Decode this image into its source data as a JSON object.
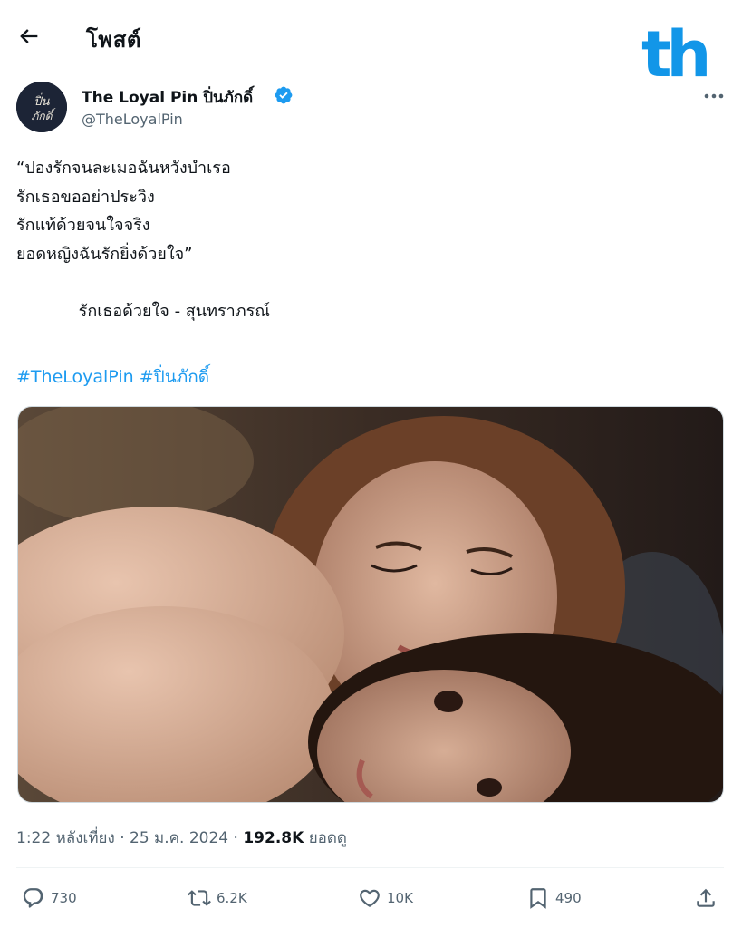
{
  "header": {
    "title": "โพสต์"
  },
  "author": {
    "name": "The Loyal Pin ปิ่นภักดิ์",
    "handle": "@TheLoyalPin",
    "avatar_text": "ปิ่น ภักดิ์"
  },
  "tweet": {
    "text": "“ปองรักจนละเมอฉันหวังบำเรอ\nรักเธอขออย่าประวิง\nรักแท้ด้วยจนใจจริง\nยอดหญิงฉันรักยิ่งด้วยใจ”\n\n            รักเธอด้วยใจ - สุนทราภรณ์",
    "hashtags": [
      "#TheLoyalPin",
      "#ปิ่นภักดิ์"
    ]
  },
  "meta": {
    "time": "1:22 หลังเที่ยง",
    "date": "25 ม.ค. 2024",
    "views": "192.8K",
    "views_label": "ยอดดู",
    "separator": "·"
  },
  "actions": {
    "replies": "730",
    "reposts": "6.2K",
    "likes": "10K",
    "bookmarks": "490"
  },
  "watermark": {
    "text": "th",
    "color": "#1296e8"
  },
  "colors": {
    "link": "#1d9bf0",
    "secondary_text": "#536471",
    "primary_text": "#0f1419"
  }
}
